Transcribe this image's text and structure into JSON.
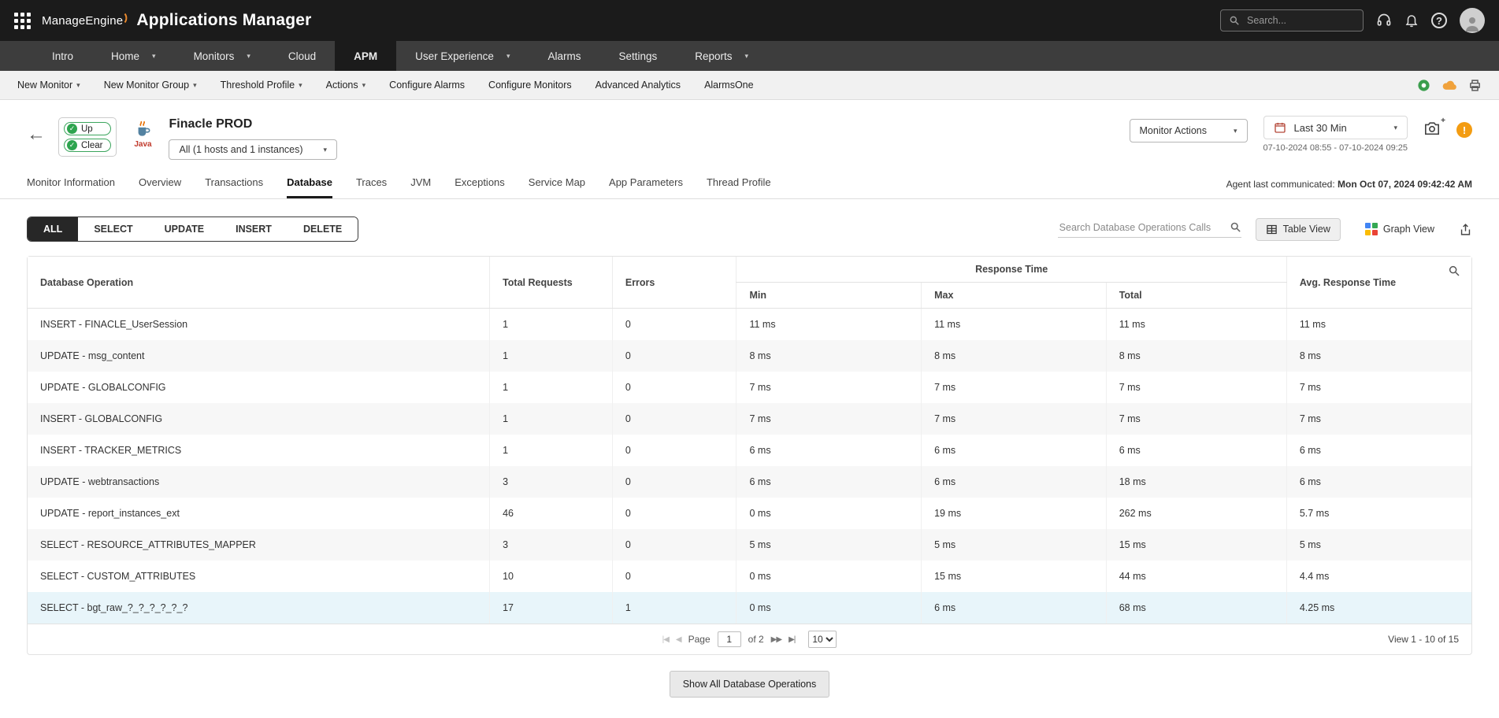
{
  "colors": {
    "accent_dark": "#1b1b1b",
    "status_green": "#2ea44f",
    "warning_orange": "#f39c12",
    "highlight_row": "#e8f5fa"
  },
  "topbar": {
    "brand": "ManageEngine",
    "app_title": "Applications Manager",
    "search_placeholder": "Search..."
  },
  "nav": {
    "active": "APM",
    "items": [
      "Intro",
      "Home",
      "Monitors",
      "Cloud",
      "APM",
      "User Experience",
      "Alarms",
      "Settings",
      "Reports"
    ]
  },
  "subnav": {
    "items": [
      "New Monitor",
      "New Monitor Group",
      "Threshold Profile",
      "Actions",
      "Configure Alarms",
      "Configure Monitors",
      "Advanced Analytics",
      "AlarmsOne"
    ]
  },
  "monitor": {
    "status_up": "Up",
    "status_clear": "Clear",
    "type_label": "Java",
    "title": "Finacle PROD",
    "instance_selector": "All (1 hosts and 1 instances)",
    "actions_label": "Monitor Actions",
    "time_range": "Last 30 Min",
    "time_range_detail": "07-10-2024 08:55 - 07-10-2024 09:25",
    "agent_label": "Agent last communicated:",
    "agent_value": "Mon Oct 07, 2024 09:42:42 AM"
  },
  "tabs": {
    "active": "Database",
    "items": [
      "Monitor Information",
      "Overview",
      "Transactions",
      "Database",
      "Traces",
      "JVM",
      "Exceptions",
      "Service Map",
      "App Parameters",
      "Thread Profile"
    ]
  },
  "filters": {
    "active": "ALL",
    "items": [
      "ALL",
      "SELECT",
      "UPDATE",
      "INSERT",
      "DELETE"
    ]
  },
  "toolbar": {
    "search_placeholder": "Search Database Operations Calls",
    "table_view_label": "Table View",
    "graph_view_label": "Graph View"
  },
  "table": {
    "headers": {
      "operation": "Database Operation",
      "requests": "Total Requests",
      "errors": "Errors",
      "response_time_group": "Response Time",
      "min": "Min",
      "max": "Max",
      "total": "Total",
      "avg": "Avg. Response Time"
    },
    "rows": [
      {
        "operation": "INSERT - FINACLE_UserSession",
        "requests": "1",
        "errors": "0",
        "min": "11 ms",
        "max": "11 ms",
        "total": "11 ms",
        "avg": "11 ms"
      },
      {
        "operation": "UPDATE - msg_content",
        "requests": "1",
        "errors": "0",
        "min": "8 ms",
        "max": "8 ms",
        "total": "8 ms",
        "avg": "8 ms"
      },
      {
        "operation": "UPDATE - GLOBALCONFIG",
        "requests": "1",
        "errors": "0",
        "min": "7 ms",
        "max": "7 ms",
        "total": "7 ms",
        "avg": "7 ms"
      },
      {
        "operation": "INSERT - GLOBALCONFIG",
        "requests": "1",
        "errors": "0",
        "min": "7 ms",
        "max": "7 ms",
        "total": "7 ms",
        "avg": "7 ms"
      },
      {
        "operation": "INSERT - TRACKER_METRICS",
        "requests": "1",
        "errors": "0",
        "min": "6 ms",
        "max": "6 ms",
        "total": "6 ms",
        "avg": "6 ms"
      },
      {
        "operation": "UPDATE - webtransactions",
        "requests": "3",
        "errors": "0",
        "min": "6 ms",
        "max": "6 ms",
        "total": "18 ms",
        "avg": "6 ms"
      },
      {
        "operation": "UPDATE - report_instances_ext",
        "requests": "46",
        "errors": "0",
        "min": "0 ms",
        "max": "19 ms",
        "total": "262 ms",
        "avg": "5.7 ms"
      },
      {
        "operation": "SELECT - RESOURCE_ATTRIBUTES_MAPPER",
        "requests": "3",
        "errors": "0",
        "min": "5 ms",
        "max": "5 ms",
        "total": "15 ms",
        "avg": "5 ms"
      },
      {
        "operation": "SELECT - CUSTOM_ATTRIBUTES",
        "requests": "10",
        "errors": "0",
        "min": "0 ms",
        "max": "15 ms",
        "total": "44 ms",
        "avg": "4.4 ms"
      },
      {
        "operation": "SELECT - bgt_raw_?_?_?_?_?_?",
        "requests": "17",
        "errors": "1",
        "min": "0 ms",
        "max": "6 ms",
        "total": "68 ms",
        "avg": "4.25 ms"
      }
    ]
  },
  "pagination": {
    "page_label": "Page",
    "page_value": "1",
    "of_text": "of 2",
    "page_size": "10",
    "view_info": "View 1 - 10 of 15"
  },
  "footer": {
    "show_all_label": "Show All Database Operations"
  }
}
